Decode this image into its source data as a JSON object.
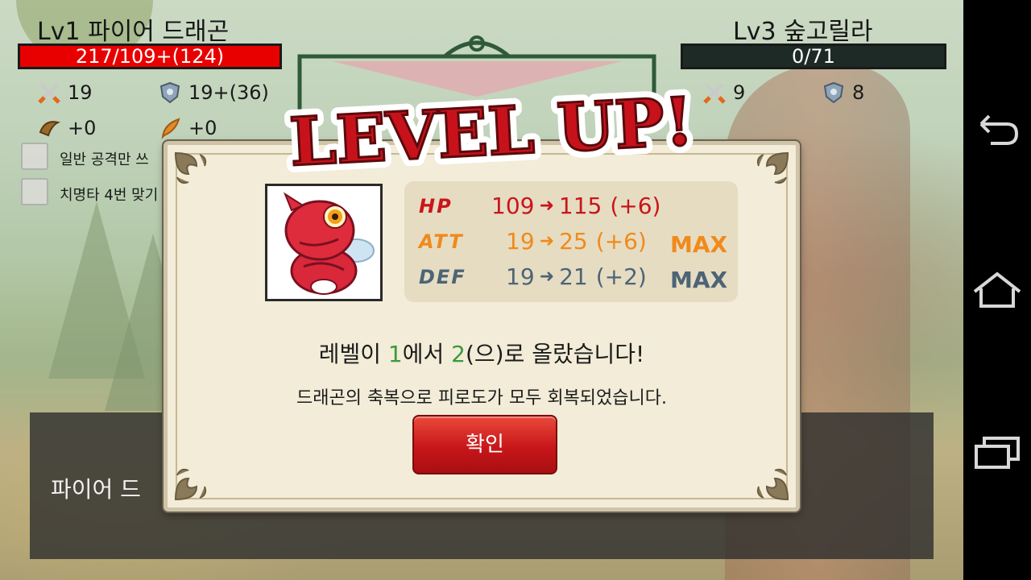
{
  "player": {
    "name": "Lv1 파이어 드래곤",
    "hp_text": "217/109+(124)",
    "hp_fraction": 1.0,
    "attack": "19",
    "defense": "19+(36)",
    "bonus1": "+0",
    "bonus2": "+0"
  },
  "enemy": {
    "name": "Lv3 숲고릴라",
    "hp_text": "0/71",
    "hp_fraction": 0,
    "attack": "9",
    "defense": "8"
  },
  "options": [
    {
      "label": "일반 공격만 쓰"
    },
    {
      "label": "치명타 4번 맞기"
    }
  ],
  "log": {
    "text": "파이어 드"
  },
  "dialog": {
    "title": "LEVEL UP!",
    "stats": [
      {
        "label": "HP",
        "from": "109",
        "to": "115",
        "delta": "(+6)",
        "max": "",
        "color": "#c8161a"
      },
      {
        "label": "ATT",
        "from": "19",
        "to": "25",
        "delta": "(+6)",
        "max": "MAX",
        "color": "#f08a1c"
      },
      {
        "label": "DEF",
        "from": "19",
        "to": "21",
        "delta": "(+2)",
        "max": "MAX",
        "color": "#4d6477"
      }
    ],
    "message": {
      "pre": "레벨이 ",
      "from_level": "1",
      "mid": "에서 ",
      "to_level": "2",
      "post": "(으)로 올랐습니다!"
    },
    "sub_message": "드래곤의 축복으로 피로도가 모두 회복되었습니다.",
    "confirm_label": "확인"
  },
  "colors": {
    "hp_red": "#e80000",
    "hp_empty": "#1e2a26",
    "level_green": "#3a9a3a"
  },
  "icons": {
    "attack": "crossed-swords-icon",
    "defense": "shield-icon",
    "bonus1": "horn-icon",
    "bonus2": "feather-icon"
  },
  "navigation": [
    "back-icon",
    "home-icon",
    "recent-apps-icon"
  ]
}
